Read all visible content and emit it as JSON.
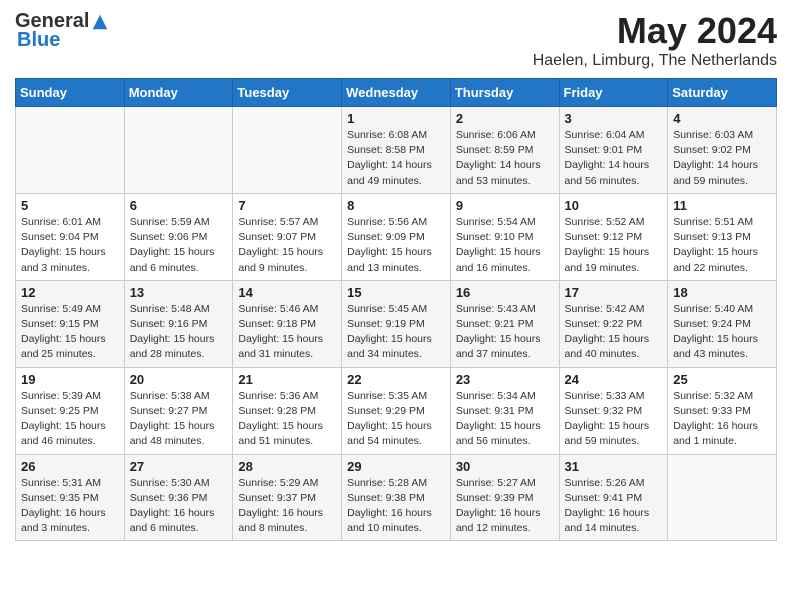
{
  "logo": {
    "general": "General",
    "blue": "Blue"
  },
  "title": "May 2024",
  "subtitle": "Haelen, Limburg, The Netherlands",
  "weekdays": [
    "Sunday",
    "Monday",
    "Tuesday",
    "Wednesday",
    "Thursday",
    "Friday",
    "Saturday"
  ],
  "weeks": [
    [
      {
        "day": "",
        "info": ""
      },
      {
        "day": "",
        "info": ""
      },
      {
        "day": "",
        "info": ""
      },
      {
        "day": "1",
        "info": "Sunrise: 6:08 AM\nSunset: 8:58 PM\nDaylight: 14 hours\nand 49 minutes."
      },
      {
        "day": "2",
        "info": "Sunrise: 6:06 AM\nSunset: 8:59 PM\nDaylight: 14 hours\nand 53 minutes."
      },
      {
        "day": "3",
        "info": "Sunrise: 6:04 AM\nSunset: 9:01 PM\nDaylight: 14 hours\nand 56 minutes."
      },
      {
        "day": "4",
        "info": "Sunrise: 6:03 AM\nSunset: 9:02 PM\nDaylight: 14 hours\nand 59 minutes."
      }
    ],
    [
      {
        "day": "5",
        "info": "Sunrise: 6:01 AM\nSunset: 9:04 PM\nDaylight: 15 hours\nand 3 minutes."
      },
      {
        "day": "6",
        "info": "Sunrise: 5:59 AM\nSunset: 9:06 PM\nDaylight: 15 hours\nand 6 minutes."
      },
      {
        "day": "7",
        "info": "Sunrise: 5:57 AM\nSunset: 9:07 PM\nDaylight: 15 hours\nand 9 minutes."
      },
      {
        "day": "8",
        "info": "Sunrise: 5:56 AM\nSunset: 9:09 PM\nDaylight: 15 hours\nand 13 minutes."
      },
      {
        "day": "9",
        "info": "Sunrise: 5:54 AM\nSunset: 9:10 PM\nDaylight: 15 hours\nand 16 minutes."
      },
      {
        "day": "10",
        "info": "Sunrise: 5:52 AM\nSunset: 9:12 PM\nDaylight: 15 hours\nand 19 minutes."
      },
      {
        "day": "11",
        "info": "Sunrise: 5:51 AM\nSunset: 9:13 PM\nDaylight: 15 hours\nand 22 minutes."
      }
    ],
    [
      {
        "day": "12",
        "info": "Sunrise: 5:49 AM\nSunset: 9:15 PM\nDaylight: 15 hours\nand 25 minutes."
      },
      {
        "day": "13",
        "info": "Sunrise: 5:48 AM\nSunset: 9:16 PM\nDaylight: 15 hours\nand 28 minutes."
      },
      {
        "day": "14",
        "info": "Sunrise: 5:46 AM\nSunset: 9:18 PM\nDaylight: 15 hours\nand 31 minutes."
      },
      {
        "day": "15",
        "info": "Sunrise: 5:45 AM\nSunset: 9:19 PM\nDaylight: 15 hours\nand 34 minutes."
      },
      {
        "day": "16",
        "info": "Sunrise: 5:43 AM\nSunset: 9:21 PM\nDaylight: 15 hours\nand 37 minutes."
      },
      {
        "day": "17",
        "info": "Sunrise: 5:42 AM\nSunset: 9:22 PM\nDaylight: 15 hours\nand 40 minutes."
      },
      {
        "day": "18",
        "info": "Sunrise: 5:40 AM\nSunset: 9:24 PM\nDaylight: 15 hours\nand 43 minutes."
      }
    ],
    [
      {
        "day": "19",
        "info": "Sunrise: 5:39 AM\nSunset: 9:25 PM\nDaylight: 15 hours\nand 46 minutes."
      },
      {
        "day": "20",
        "info": "Sunrise: 5:38 AM\nSunset: 9:27 PM\nDaylight: 15 hours\nand 48 minutes."
      },
      {
        "day": "21",
        "info": "Sunrise: 5:36 AM\nSunset: 9:28 PM\nDaylight: 15 hours\nand 51 minutes."
      },
      {
        "day": "22",
        "info": "Sunrise: 5:35 AM\nSunset: 9:29 PM\nDaylight: 15 hours\nand 54 minutes."
      },
      {
        "day": "23",
        "info": "Sunrise: 5:34 AM\nSunset: 9:31 PM\nDaylight: 15 hours\nand 56 minutes."
      },
      {
        "day": "24",
        "info": "Sunrise: 5:33 AM\nSunset: 9:32 PM\nDaylight: 15 hours\nand 59 minutes."
      },
      {
        "day": "25",
        "info": "Sunrise: 5:32 AM\nSunset: 9:33 PM\nDaylight: 16 hours\nand 1 minute."
      }
    ],
    [
      {
        "day": "26",
        "info": "Sunrise: 5:31 AM\nSunset: 9:35 PM\nDaylight: 16 hours\nand 3 minutes."
      },
      {
        "day": "27",
        "info": "Sunrise: 5:30 AM\nSunset: 9:36 PM\nDaylight: 16 hours\nand 6 minutes."
      },
      {
        "day": "28",
        "info": "Sunrise: 5:29 AM\nSunset: 9:37 PM\nDaylight: 16 hours\nand 8 minutes."
      },
      {
        "day": "29",
        "info": "Sunrise: 5:28 AM\nSunset: 9:38 PM\nDaylight: 16 hours\nand 10 minutes."
      },
      {
        "day": "30",
        "info": "Sunrise: 5:27 AM\nSunset: 9:39 PM\nDaylight: 16 hours\nand 12 minutes."
      },
      {
        "day": "31",
        "info": "Sunrise: 5:26 AM\nSunset: 9:41 PM\nDaylight: 16 hours\nand 14 minutes."
      },
      {
        "day": "",
        "info": ""
      }
    ]
  ]
}
